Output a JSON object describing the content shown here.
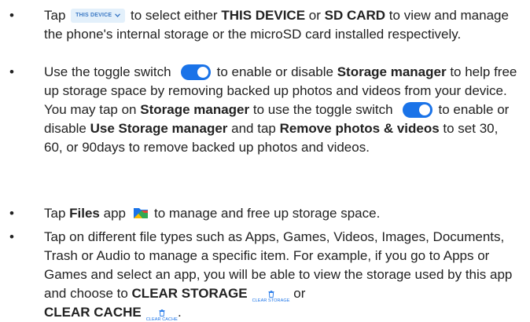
{
  "bullet": "•",
  "items": [
    {
      "pre": "Tap ",
      "chip_label": "THIS DEVICE",
      "mid1": " to select either ",
      "b1": "THIS DEVICE",
      "mid2": " or ",
      "b2": "SD CARD",
      "post": " to view and manage the phone's internal storage or the microSD card installed respectively."
    },
    {
      "pre": "Use the toggle switch",
      "mid1": "to enable or disable ",
      "b1": "Storage manager",
      "mid2": " to help free up storage space by removing backed up photos and videos from your device. You may tap on ",
      "b2": "Storage manager",
      "mid3": " to use the toggle switch",
      "mid4": "to enable or disable ",
      "b3": "Use Storage manager",
      "mid5": " and tap ",
      "b4": "Remove photos & videos",
      "post": " to set 30, 60, or 90days to remove backed up photos and videos."
    },
    {
      "pre": "Tap ",
      "b1": "Files",
      "mid1": " app",
      "post": "to manage and free up storage space."
    },
    {
      "text": "Tap on different file types such as Apps, Games, Videos, Images, Documents, Trash or Audio to manage a specific item. For example, if you go to Apps or Games and select an app, you will be able to view the storage used by this app and choose to ",
      "b1": "CLEAR STORAGE",
      "mini1": "CLEAR STORAGE",
      "mid1": " or",
      "b2": "CLEAR CACHE",
      "mini2": "CLEAR CACHE",
      "post": "."
    }
  ],
  "colors": {
    "text": "#222222",
    "accent_blue": "#1a73e8",
    "chip_bg": "#e3f0fb",
    "chip_text": "#3a78c4"
  },
  "icons": [
    "chevron-down-icon",
    "toggle-switch-icon",
    "files-app-icon",
    "trash-icon"
  ]
}
